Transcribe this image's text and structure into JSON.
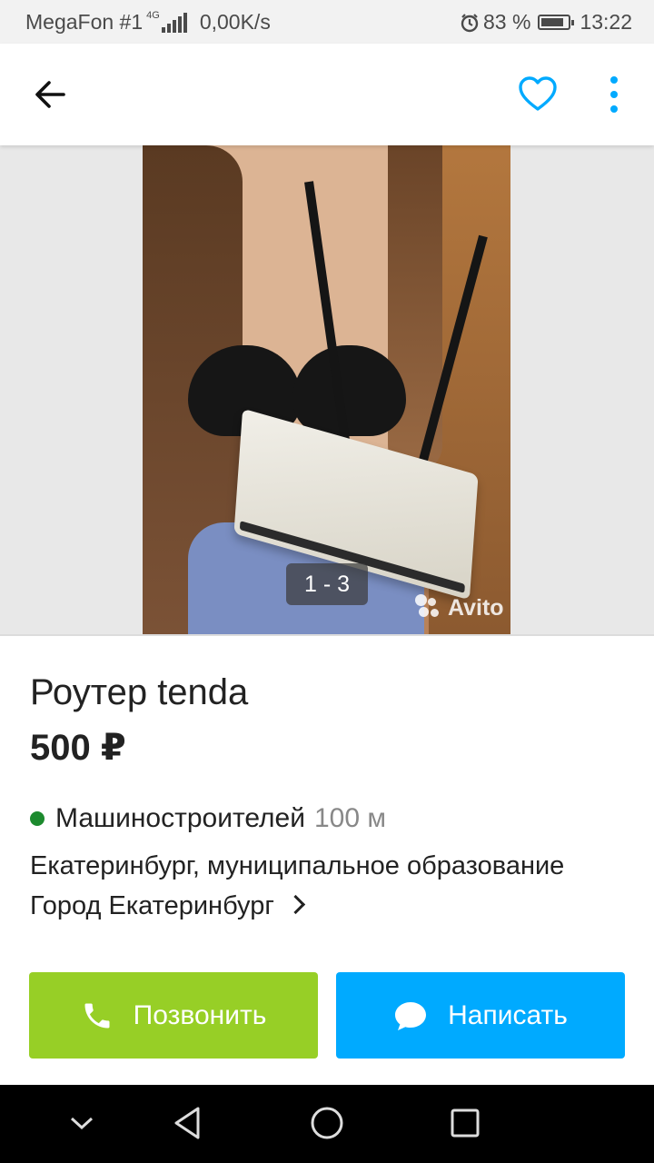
{
  "status_bar": {
    "carrier": "MegaFon #1",
    "network": "4G",
    "speed": "0,00K/s",
    "battery_percent": "83 %",
    "battery_level": 0.83,
    "time": "13:22"
  },
  "header": {
    "back_icon": "arrow-left-icon",
    "favorite_icon": "heart-outline-icon",
    "more_icon": "more-vertical-icon",
    "accent_color": "#00aaff"
  },
  "gallery": {
    "counter": "1 - 3",
    "watermark": "Avito"
  },
  "listing": {
    "title": "Роутер tenda",
    "price": "500 ₽",
    "metro_station": "Машиностроителей",
    "metro_distance": "100 м",
    "metro_color": "#1c8a2e",
    "address": "Екатеринбург, муниципальное образование Город Екатеринбург"
  },
  "actions": {
    "call_label": "Позвонить",
    "call_color": "#97cf26",
    "message_label": "Написать",
    "message_color": "#00aaff"
  },
  "nav_bar": {
    "icons": [
      "chevron-down-icon",
      "back-triangle-icon",
      "home-circle-icon",
      "recents-square-icon"
    ]
  }
}
